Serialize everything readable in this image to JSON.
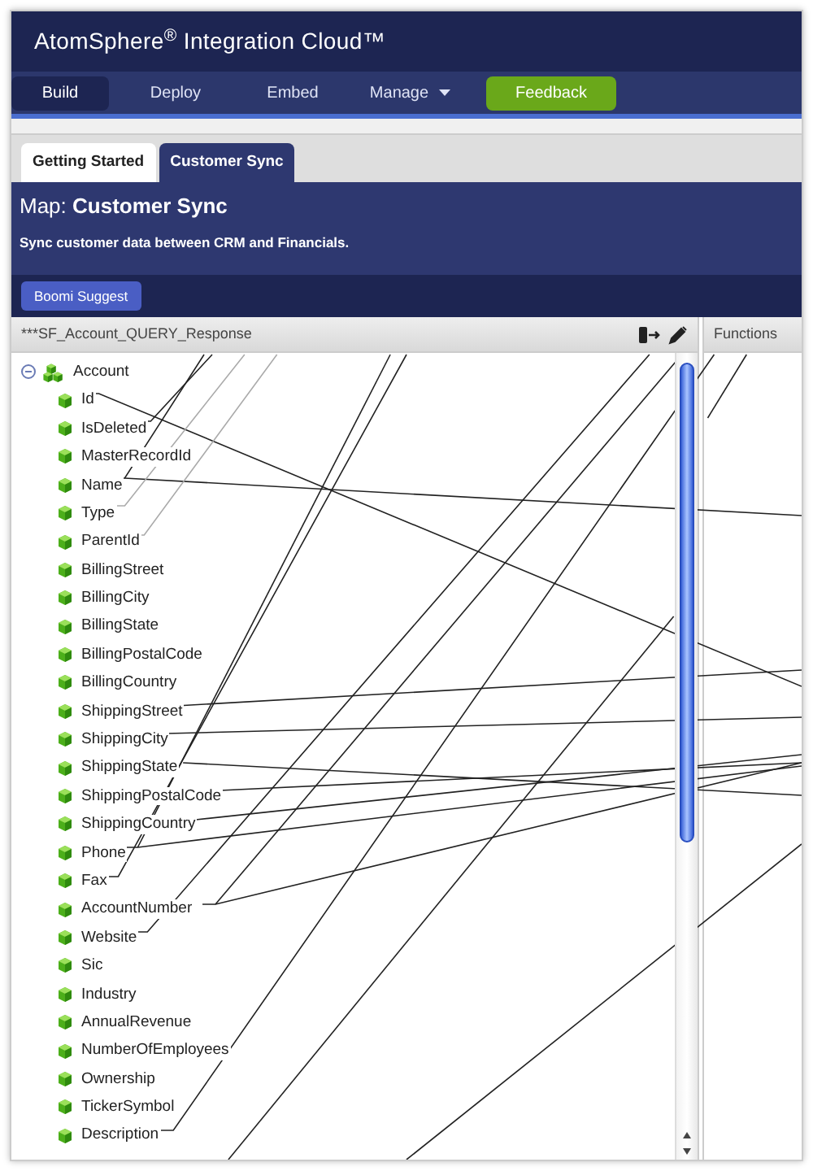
{
  "app": {
    "title": "AtomSphere$^{®}$ Integration Cloud™"
  },
  "nav": [
    {
      "label": "Build",
      "kind": "link",
      "selected": true
    },
    {
      "label": "Deploy",
      "kind": "link",
      "selected": false
    },
    {
      "label": "Embed",
      "kind": "link",
      "selected": false
    },
    {
      "label": "Manage",
      "kind": "dropdown",
      "selected": false
    },
    {
      "label": "Feedback",
      "kind": "button",
      "selected": false
    }
  ],
  "tabs": [
    {
      "label": "Getting Started",
      "selected": false
    },
    {
      "label": "Customer Sync",
      "selected": true
    }
  ],
  "map": {
    "title": "Map: **Customer Sync**",
    "description": "Sync customer data between CRM and Financials.",
    "toolbar_button": "Boomi Suggest"
  },
  "source_panel": {
    "title": "***SF_Account_QUERY_Response",
    "tree": [
      {
        "label": "Account",
        "expanded": true,
        "children": [
          {
            "label": "Id"
          },
          {
            "label": "IsDeleted"
          },
          {
            "label": "MasterRecordId"
          },
          {
            "label": "Name"
          },
          {
            "label": "Type"
          },
          {
            "label": "ParentId"
          },
          {
            "label": "BillingStreet"
          },
          {
            "label": "BillingCity"
          },
          {
            "label": "BillingState"
          },
          {
            "label": "BillingPostalCode"
          },
          {
            "label": "BillingCountry"
          },
          {
            "label": "ShippingStreet"
          },
          {
            "label": "ShippingCity"
          },
          {
            "label": "ShippingState"
          },
          {
            "label": "ShippingPostalCode"
          },
          {
            "label": "ShippingCountry"
          },
          {
            "label": "Phone"
          },
          {
            "label": "Fax"
          },
          {
            "label": "AccountNumber"
          },
          {
            "label": "Website"
          },
          {
            "label": "Sic"
          },
          {
            "label": "Industry"
          },
          {
            "label": "AnnualRevenue"
          },
          {
            "label": "NumberOfEmployees"
          },
          {
            "label": "Ownership"
          },
          {
            "label": "TickerSymbol"
          },
          {
            "label": "Description"
          }
        ]
      }
    ]
  },
  "functions_panel": {
    "title": "Functions"
  }
}
